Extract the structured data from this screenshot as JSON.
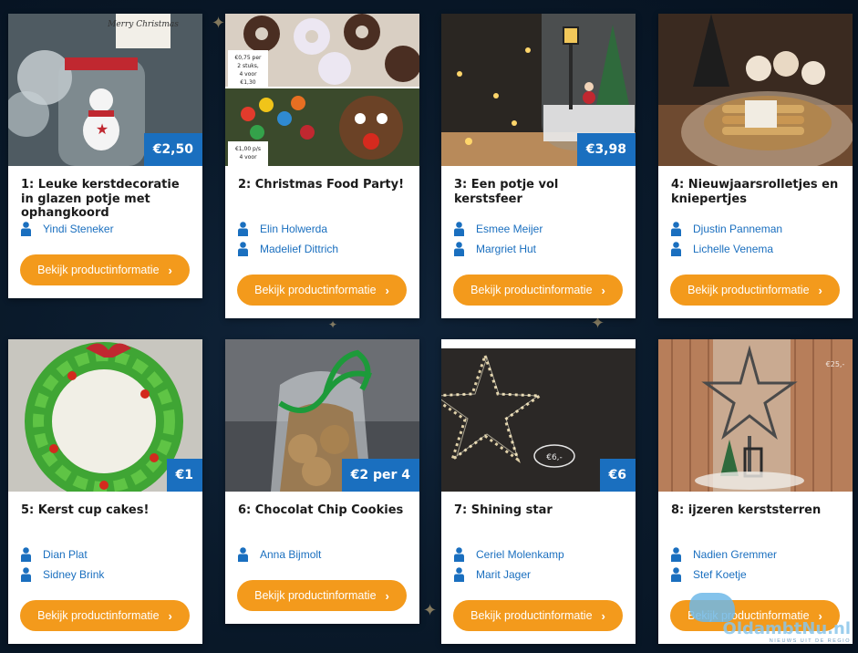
{
  "button_label": "Bekijk productinformatie",
  "products": [
    {
      "title": "1: Leuke kerstdecoratie in glazen potje met ophangkoord",
      "price": "€2,50",
      "makers": [
        "Yindi Steneker"
      ]
    },
    {
      "title": "2: Christmas Food Party!",
      "price": "",
      "makers": [
        "Elin Holwerda",
        "Madelief Dittrich"
      ]
    },
    {
      "title": "3: Een potje vol kerstsfeer",
      "price": "€3,98",
      "makers": [
        "Esmee Meijer",
        "Margriet Hut"
      ]
    },
    {
      "title": "4: Nieuwjaarsrolletjes en kniepertjes",
      "price": "",
      "makers": [
        "Djustin Panneman",
        "Lichelle Venema"
      ]
    },
    {
      "title": "5: Kerst cup cakes!",
      "price": "€1",
      "makers": [
        "Dian Plat",
        "Sidney Brink"
      ]
    },
    {
      "title": "6: Chocolat Chip Cookies",
      "price": "€2 per 4",
      "makers": [
        "Anna Bijmolt"
      ]
    },
    {
      "title": "7: Shining star",
      "price": "€6",
      "makers": [
        "Ceriel Molenkamp",
        "Marit Jager"
      ]
    },
    {
      "title": "8: ijzeren kerststerren",
      "price": "",
      "makers": [
        "Nadien Gremmer",
        "Stef Koetje"
      ]
    }
  ],
  "photo_text": {
    "p1_sign": "Merry Christmas",
    "p2_price_a": "€0,75 per 2 stuks, 4 voor €1,30",
    "p2_price_b": "€1,00 p/s 4 voor",
    "p7_tag": "€6,-",
    "p8_tag": "€25,-"
  },
  "watermark": {
    "logo": "OldambtNu.nl",
    "tagline": "NIEUWS UIT DE REGIO"
  }
}
